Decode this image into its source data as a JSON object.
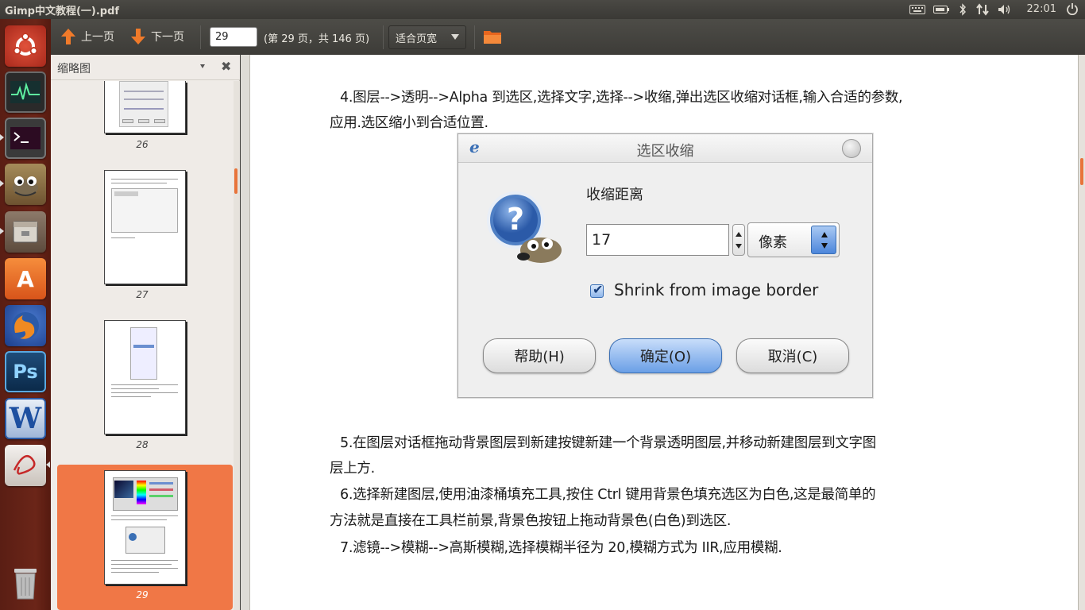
{
  "window": {
    "title": "Gimp中文教程(一).pdf"
  },
  "top_panel": {
    "clock": "22:01",
    "indicators": [
      "keyboard-icon",
      "battery-icon",
      "bluetooth-icon",
      "network-icon",
      "volume-icon",
      "power-icon"
    ]
  },
  "launcher": {
    "items": [
      "ubuntu-dash-icon",
      "system-monitor-icon",
      "terminal-icon",
      "gimp-icon",
      "files-icon",
      "software-center-icon",
      "firefox-icon",
      "photoshop-icon",
      "wps-writer-icon",
      "pdf-reader-icon",
      "trash-icon"
    ],
    "labels": {
      "ps": "Ps",
      "w": "W",
      "a": "A"
    }
  },
  "toolbar": {
    "prev_label": "上一页",
    "next_label": "下一页",
    "page_value": "29",
    "page_count": "(第 29 页，共 146 页)",
    "zoom_label": "适合页宽"
  },
  "sidebar": {
    "title": "缩略图",
    "close_glyph": "✖",
    "thumbnails": [
      {
        "page": "26"
      },
      {
        "page": "27"
      },
      {
        "page": "28"
      },
      {
        "page": "29",
        "selected": true
      }
    ]
  },
  "document": {
    "para4_line1": "4.图层-->透明-->Alpha 到选区,选择文字,选择-->收缩,弹出选区收缩对话框,输入合适的参数,",
    "para4_line2": "应用.选区缩小到合适位置.",
    "para5_line1": "5.在图层对话框拖动背景图层到新建按键新建一个背景透明图层,并移动新建图层到文字图",
    "para5_line2": "层上方.",
    "para6_line1": "6.选择新建图层,使用油漆桶填充工具,按住 Ctrl 键用背景色填充选区为白色,这是最简单的",
    "para6_line2": "方法就是直接在工具栏前景,背景色按钮上拖动背景色(白色)到选区.",
    "para7": "7.滤镜-->模糊-->高斯模糊,选择模糊半径为 20,模糊方式为 IIR,应用模糊.",
    "dialog": {
      "app_letter": "e",
      "title": "选区收缩",
      "shrink_label": "收缩距离",
      "shrink_value": "17",
      "unit": "像素",
      "checkbox_label": "Shrink from image border",
      "checkbox_checked": true,
      "help_button": "帮助(H)",
      "ok_button": "确定(O)",
      "cancel_button": "取消(C)"
    }
  },
  "colors": {
    "accent": "#f07746",
    "launcher_bg": "#6b2518",
    "toolbar_bg": "#3d3c38"
  }
}
